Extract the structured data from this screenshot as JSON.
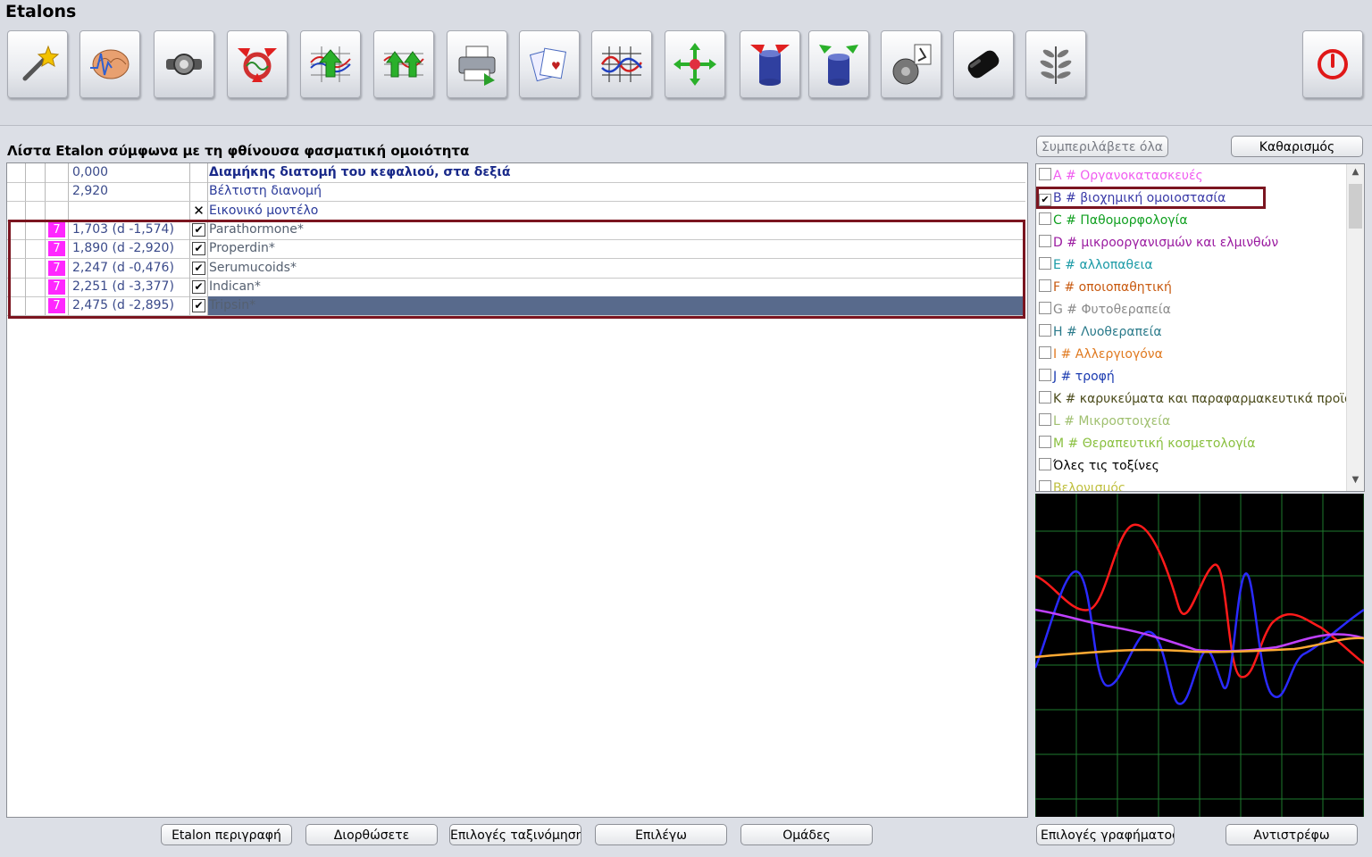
{
  "window": {
    "title": "Etalons"
  },
  "toolbar": {
    "buttons": [
      {
        "name": "magic-wand"
      },
      {
        "name": "brain"
      },
      {
        "name": "device"
      },
      {
        "name": "filter-arrows"
      },
      {
        "name": "chart-up"
      },
      {
        "name": "chart-double-up"
      },
      {
        "name": "printer"
      },
      {
        "name": "cards"
      },
      {
        "name": "waveform-grid"
      },
      {
        "name": "move-arrows"
      },
      {
        "name": "cylinder-in"
      },
      {
        "name": "cylinder-out"
      },
      {
        "name": "microscope"
      },
      {
        "name": "black-stone"
      },
      {
        "name": "herb"
      }
    ],
    "power": {
      "name": "power"
    }
  },
  "list": {
    "title": "Λίστα Etalon σύμφωνα με τη φθίνουσα φασματική ομοιότητα",
    "rows": [
      {
        "value": "0,000",
        "name": "Διαμήκης διατομή του κεφαλιού, στα δεξιά",
        "bold": true
      },
      {
        "value": "2,920",
        "name": "Βέλτιστη διανομή"
      },
      {
        "value": "",
        "name": "Εικονικό μοντέλο",
        "mark": "✕"
      },
      {
        "badge": "7",
        "value": "1,703 (d -1,574)",
        "name": "Parathormone*",
        "checked": true
      },
      {
        "badge": "7",
        "value": "1,890 (d -2,920)",
        "name": "Properdin*",
        "checked": true
      },
      {
        "badge": "7",
        "value": "2,247 (d -0,476)",
        "name": "Serumucoids*",
        "checked": true
      },
      {
        "badge": "7",
        "value": "2,251 (d -3,377)",
        "name": "Indican*",
        "checked": true
      },
      {
        "badge": "7",
        "value": "2,475 (d -2,895)",
        "name": "Tripsin*",
        "checked": true,
        "selected": true
      }
    ]
  },
  "bottom_buttons": {
    "description": "Etalon περιγραφή",
    "correct": "Διορθώσετε",
    "sort_options": "Επιλογές ταξινόμησης",
    "select": "Επιλέγω",
    "groups": "Ομάδες"
  },
  "right": {
    "include_all": "Συμπεριλάβετε όλα",
    "clear": "Καθαρισμός",
    "categories": [
      {
        "label": "A # Οργανοκατασκευές",
        "color": "#f05cf0",
        "checked": false
      },
      {
        "label": "B # βιοχημική ομοιοστασία",
        "color": "#3a3aa8",
        "checked": true
      },
      {
        "label": "C # Παθομορφολογία",
        "color": "#10a020",
        "checked": false
      },
      {
        "label": "D # μικροοργανισμών και ελμινθών",
        "color": "#9a1aa0",
        "checked": false
      },
      {
        "label": "E # αλλοπαθεια",
        "color": "#1a9aa6",
        "checked": false
      },
      {
        "label": "F # οποιοπαθητική",
        "color": "#c85a10",
        "checked": false
      },
      {
        "label": "G # Φυτοθεραπεία",
        "color": "#8a8a8a",
        "checked": false
      },
      {
        "label": "H # Λυοθεραπεία",
        "color": "#2a7a8a",
        "checked": false
      },
      {
        "label": "I # Αλλεργιογόνα",
        "color": "#e07a20",
        "checked": false
      },
      {
        "label": "J # τροφή",
        "color": "#1a3ab0",
        "checked": false
      },
      {
        "label": "K # καρυκεύματα και παραφαρμακευτικά προϊό",
        "color": "#4a4a1a",
        "checked": false
      },
      {
        "label": "L # Μικροστοιχεία",
        "color": "#a0c070",
        "checked": false
      },
      {
        "label": "M # Θεραπευτική κοσμετολογία",
        "color": "#8ac040",
        "checked": false
      },
      {
        "label": "Όλες τις τοξίνες",
        "color": "#000000",
        "checked": false
      },
      {
        "label": "Βελονισμός",
        "color": "#c0c040",
        "checked": false
      }
    ],
    "graph_options": "Επιλογές γραφήματος",
    "invert": "Αντιστρέφω"
  },
  "colors": {
    "highlight": "#7b1520",
    "selected_row": "#586a8c",
    "badge": "#ff27ff"
  }
}
